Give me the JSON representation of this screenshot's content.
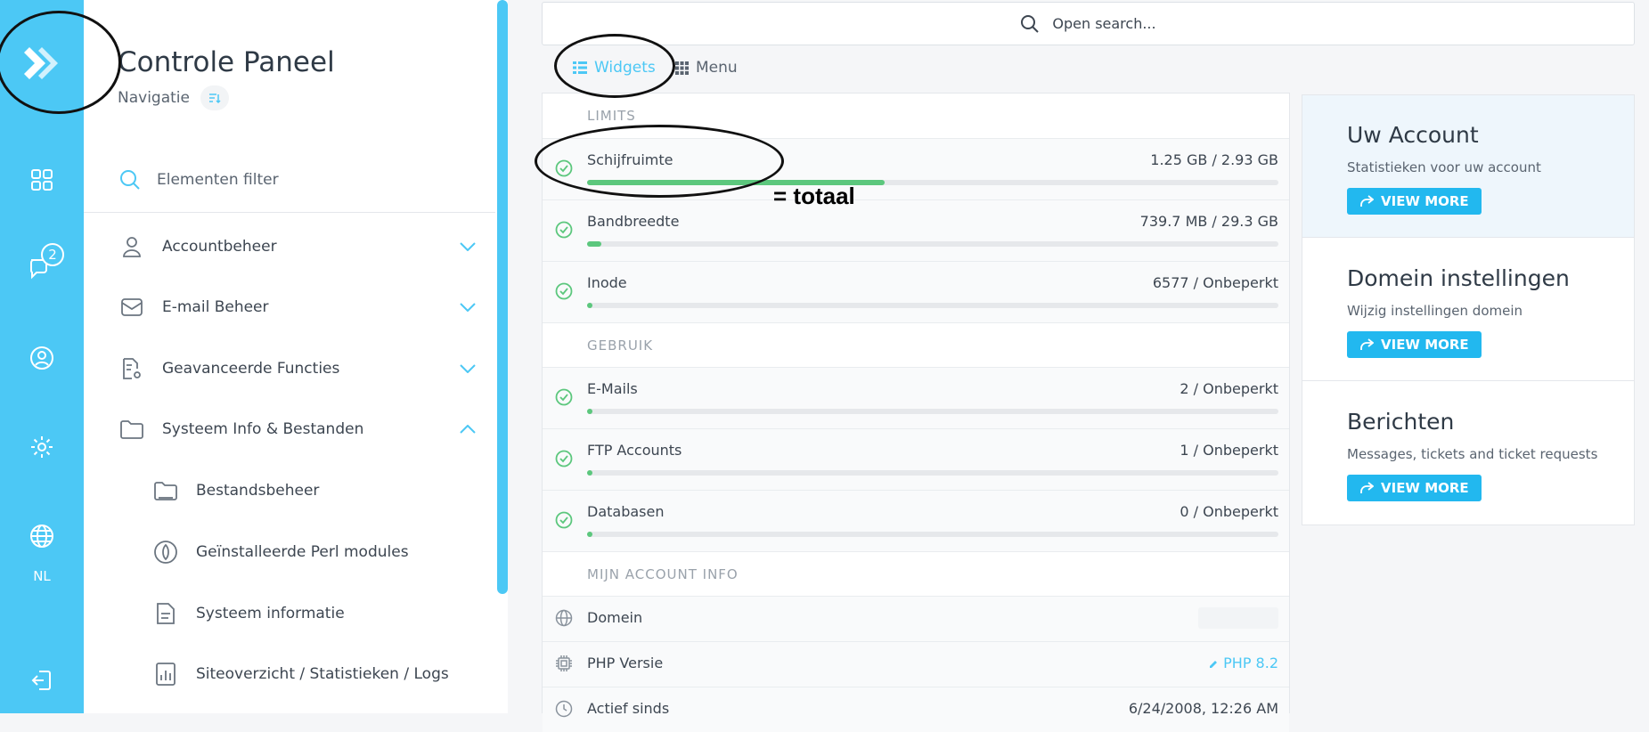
{
  "rail": {
    "badge_count": "2",
    "language": "NL"
  },
  "nav": {
    "title": "Controle Paneel",
    "subtitle": "Navigatie",
    "filter_placeholder": "Elementen filter",
    "items": [
      {
        "label": "Accountbeheer",
        "icon": "user-icon",
        "chevron": "down"
      },
      {
        "label": "E-mail Beheer",
        "icon": "mail-icon",
        "chevron": "down"
      },
      {
        "label": "Geavanceerde Functies",
        "icon": "advanced-settings-icon",
        "chevron": "down"
      },
      {
        "label": "Systeem Info & Bestanden",
        "icon": "folder-icon",
        "chevron": "up"
      }
    ],
    "subitems": [
      {
        "label": "Bestandsbeheer",
        "icon": "folder-icon"
      },
      {
        "label": "Geïnstalleerde Perl modules",
        "icon": "perl-icon"
      },
      {
        "label": "Systeem informatie",
        "icon": "document-icon"
      },
      {
        "label": "Siteoverzicht / Statistieken / Logs",
        "icon": "chart-icon"
      }
    ]
  },
  "search": {
    "placeholder": "Open search..."
  },
  "tabs": {
    "widgets": "Widgets",
    "menu": "Menu"
  },
  "limits": {
    "section_limits": "LIMITS",
    "section_usage": "GEBRUIK",
    "section_info": "MIJN ACCOUNT INFO",
    "rows": [
      {
        "label": "Schijfruimte",
        "value": "1.25 GB / 2.93 GB",
        "fraction": 0.43
      },
      {
        "label": "Bandbreedte",
        "value": "739.7 MB / 29.3 GB",
        "fraction": 0.02
      },
      {
        "label": "Inode",
        "value": "6577 / Onbeperkt",
        "fraction": 0.008
      }
    ],
    "usage_rows": [
      {
        "label": "E-Mails",
        "value": "2 / Onbeperkt",
        "fraction": 0.008
      },
      {
        "label": "FTP Accounts",
        "value": "1 / Onbeperkt",
        "fraction": 0.008
      },
      {
        "label": "Databasen",
        "value": "0 / Onbeperkt",
        "fraction": 0.008
      }
    ],
    "info_rows": [
      {
        "label": "Domein",
        "value": ""
      },
      {
        "label": "PHP Versie",
        "value": "PHP 8.2"
      },
      {
        "label": "Actief sinds",
        "value": "6/24/2008, 12:26 AM"
      }
    ]
  },
  "cards": [
    {
      "title": "Uw Account",
      "subtitle": "Statistieken voor uw account",
      "button": "VIEW MORE"
    },
    {
      "title": "Domein instellingen",
      "subtitle": "Wijzig instellingen domein",
      "button": "VIEW MORE"
    },
    {
      "title": "Berichten",
      "subtitle": "Messages, tickets and ticket requests",
      "button": "VIEW MORE"
    }
  ],
  "annotation": {
    "text": "= totaal"
  },
  "colors": {
    "accent": "#4cc8f5",
    "button": "#22b8ef",
    "progress": "#5cc77d"
  }
}
